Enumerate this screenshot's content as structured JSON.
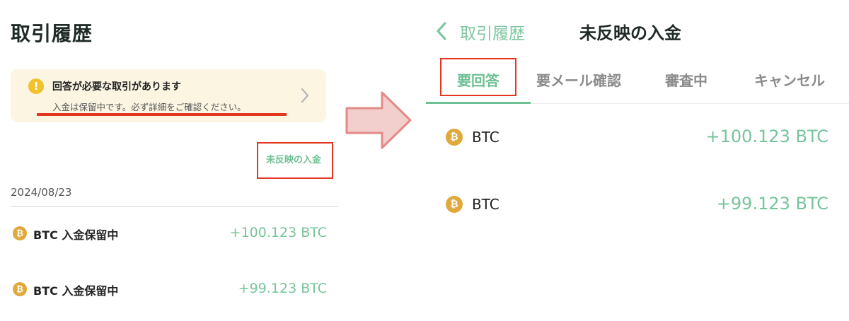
{
  "left": {
    "title": "取引履歴",
    "alert": {
      "icon": "exclamation-icon",
      "title": "回答が必要な取引があります",
      "subtitle": "入金は保留中です。必ず詳細をご確認ください。"
    },
    "unreflected_link": "未反映の入金",
    "date": "2024/08/23",
    "transactions": [
      {
        "icon": "bitcoin-icon",
        "label": "BTC 入金保留中",
        "amount": "+100.123 BTC"
      },
      {
        "icon": "bitcoin-icon",
        "label": "BTC 入金保留中",
        "amount": "+99.123 BTC"
      }
    ]
  },
  "right": {
    "back_label": "取引履歴",
    "title": "未反映の入金",
    "tabs": [
      {
        "label": "要回答",
        "active": true
      },
      {
        "label": "要メール確認",
        "active": false
      },
      {
        "label": "審査中",
        "active": false
      },
      {
        "label": "キャンセル",
        "active": false
      }
    ],
    "rows": [
      {
        "icon": "bitcoin-icon",
        "label": "BTC",
        "amount": "+100.123 BTC"
      },
      {
        "icon": "bitcoin-icon",
        "label": "BTC",
        "amount": "+99.123 BTC"
      }
    ]
  },
  "colors": {
    "accent_green": "#6cc093",
    "highlight_red": "#e3361e",
    "alert_bg": "#fbf5e2",
    "bitcoin_orange": "#e1a93b"
  }
}
